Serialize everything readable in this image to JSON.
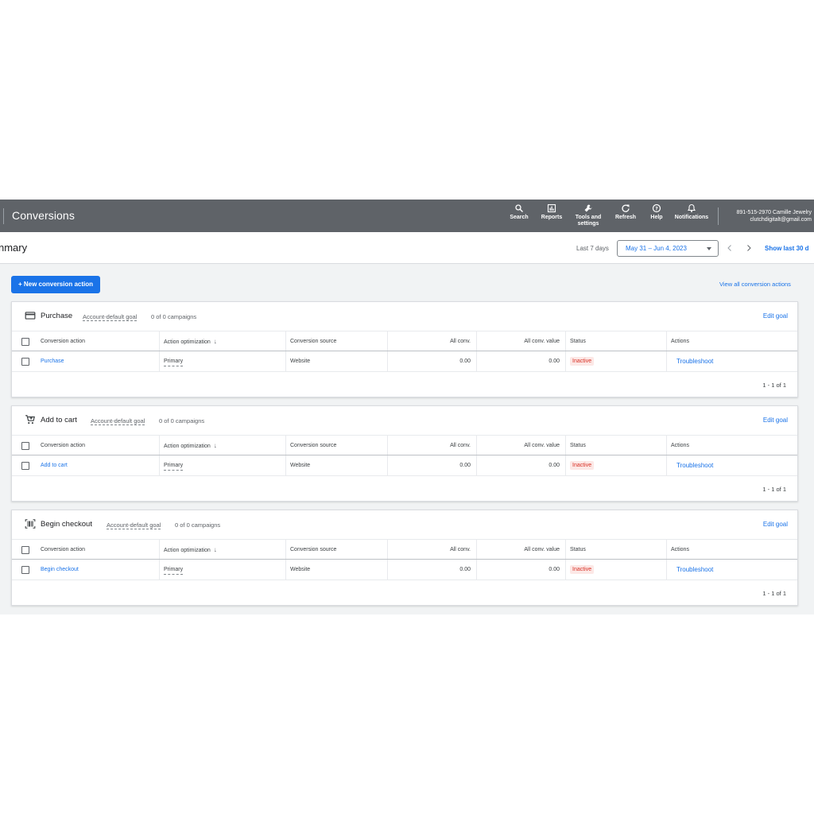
{
  "topbar": {
    "title": "Conversions",
    "tools": [
      {
        "label": "Search",
        "icon": "search-icon"
      },
      {
        "label": "Reports",
        "icon": "reports-icon"
      },
      {
        "label": "Tools and settings",
        "icon": "wrench-icon"
      },
      {
        "label": "Refresh",
        "icon": "refresh-icon"
      },
      {
        "label": "Help",
        "icon": "help-icon"
      },
      {
        "label": "Notifications",
        "icon": "bell-icon"
      }
    ],
    "account_line1": "891-515-2970 Camille Jewelry",
    "account_line2": "clutchdigitalt@gmail.com"
  },
  "subbar": {
    "page_title": "nmary",
    "range_label": "Last 7 days",
    "date_range": "May 31 – Jun 4, 2023",
    "show_last": "Show last 30 d"
  },
  "actions": {
    "new_button": "+ New conversion action",
    "view_all": "View all conversion actions"
  },
  "table_headers": {
    "conversion_action": "Conversion action",
    "action_optimization": "Action optimization",
    "conversion_source": "Conversion source",
    "all_conv": "All conv.",
    "all_conv_value": "All conv. value",
    "status": "Status",
    "actions": "Actions"
  },
  "goals": [
    {
      "name": "Purchase",
      "icon": "credit-card-icon",
      "tag": "Account-default goal",
      "campaigns": "0 of 0 campaigns",
      "edit": "Edit goal",
      "row": {
        "action": "Purchase",
        "optimization": "Primary",
        "source": "Website",
        "all_conv": "0.00",
        "all_conv_value": "0.00",
        "status": "Inactive",
        "troubleshoot": "Troubleshoot"
      },
      "pager": "1 - 1 of 1"
    },
    {
      "name": "Add to cart",
      "icon": "cart-icon",
      "tag": "Account-default goal",
      "campaigns": "0 of 0 campaigns",
      "edit": "Edit goal",
      "row": {
        "action": "Add to cart",
        "optimization": "Primary",
        "source": "Website",
        "all_conv": "0.00",
        "all_conv_value": "0.00",
        "status": "Inactive",
        "troubleshoot": "Troubleshoot"
      },
      "pager": "1 - 1 of 1"
    },
    {
      "name": "Begin checkout",
      "icon": "barcode-icon",
      "tag": "Account-default goal",
      "campaigns": "0 of 0 campaigns",
      "edit": "Edit goal",
      "row": {
        "action": "Begin checkout",
        "optimization": "Primary",
        "source": "Website",
        "all_conv": "0.00",
        "all_conv_value": "0.00",
        "status": "Inactive",
        "troubleshoot": "Troubleshoot"
      },
      "pager": "1 - 1 of 1"
    }
  ]
}
